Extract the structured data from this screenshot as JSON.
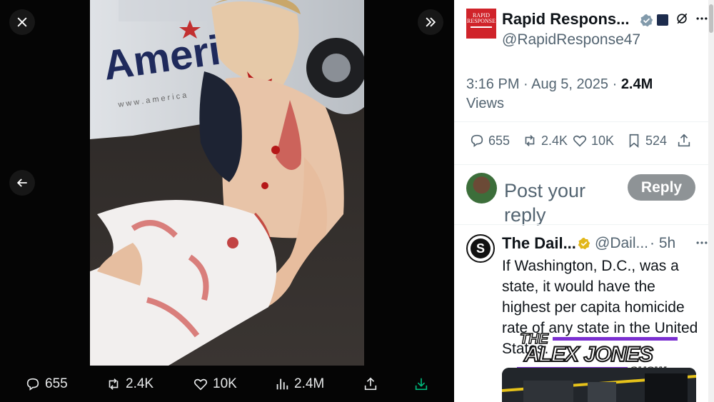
{
  "viewer": {
    "close_icon": "close-icon",
    "expand_icon": "chevrons-right-icon",
    "back_icon": "arrow-left-icon",
    "actions": {
      "replies": "655",
      "reposts": "2.4K",
      "likes": "10K",
      "views": "2.4M"
    },
    "van_text": "America",
    "van_url": "w w w . a m e r i c a"
  },
  "post": {
    "author_name": "Rapid Respons...",
    "author_handle": "@RapidResponse47",
    "avatar_text": "RAPID RESPONSE",
    "time": "3:16 PM · Aug 5, 2025 ·",
    "views_count": "2.4M",
    "views_label": "Views",
    "stats": {
      "replies": "655",
      "reposts": "2.4K",
      "likes": "10K",
      "bookmarks": "524"
    }
  },
  "composer": {
    "placeholder": "Post your reply",
    "reply_label": "Reply"
  },
  "reply": {
    "avatar_letter": "S",
    "name": "The Dail...",
    "handle": "@Dail...",
    "time": "· 5h",
    "text": "If Washington, D.C., was a state, it would have the highest per capita homicide rate of any state in the United States.",
    "banner": {
      "line1": "THE",
      "line2": "ALEX JONES",
      "line3": "SHOW"
    }
  },
  "colors": {
    "verified_blue": "#1d9bf0",
    "verified_gold": "#e2b719",
    "reply_button": "#8e9396",
    "brand_red": "#d0232a"
  }
}
